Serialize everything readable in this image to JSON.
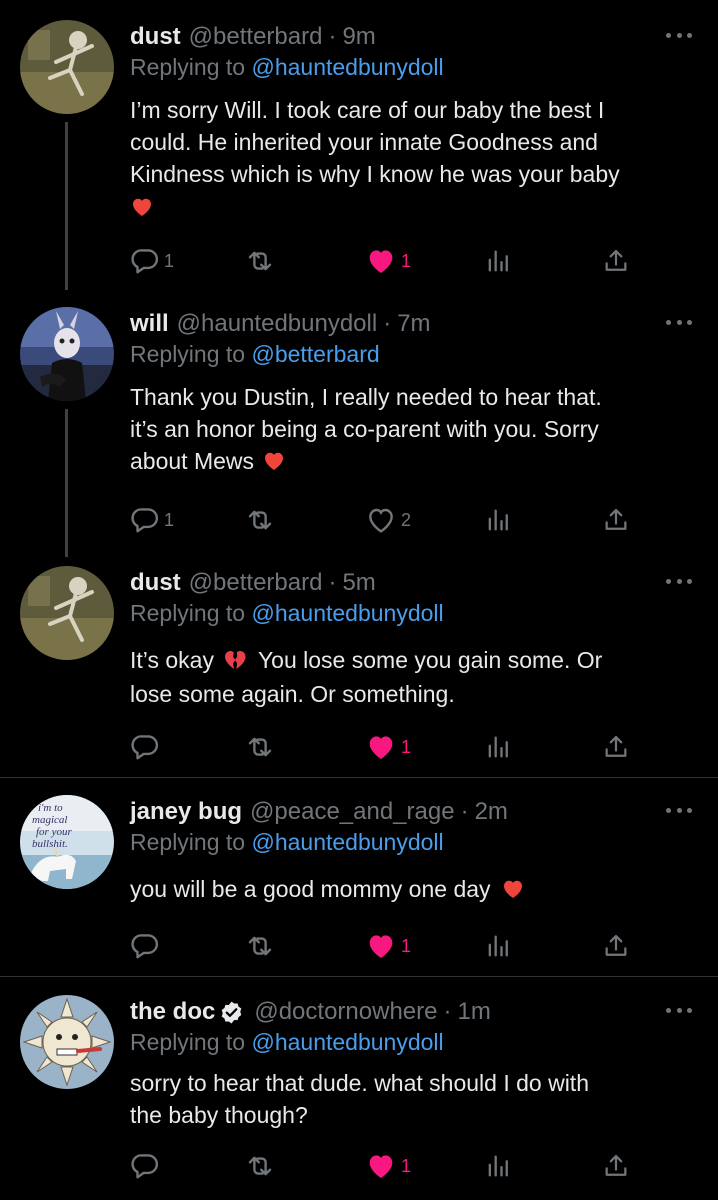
{
  "tweets": [
    {
      "name": "dust",
      "handle": "@betterbard",
      "time": "9m",
      "replying_prefix": "Replying to",
      "replying_to": "@hauntedbunydoll",
      "lines": [
        "I’m sorry Will. I took care of our baby the best I",
        "could. He inherited your innate Goodness and",
        "Kindness which is why I know he was your baby"
      ],
      "emoji": "red-heart",
      "reply_count": "1",
      "retweet_count": "",
      "like_count": "1",
      "liked": true,
      "avatar": "skeleton-dancing-avatar"
    },
    {
      "name": "will",
      "handle": "@hauntedbunydoll",
      "time": "7m",
      "replying_prefix": "Replying to",
      "replying_to": "@betterbard",
      "lines": [
        "Thank you Dustin, I really needed to hear that.",
        "it’s an honor being a co-parent with you. Sorry",
        "about Mews"
      ],
      "emoji": "red-heart",
      "reply_count": "1",
      "retweet_count": "",
      "like_count": "2",
      "liked": false,
      "avatar": "bunny-mask-avatar"
    },
    {
      "name": "dust",
      "handle": "@betterbard",
      "time": "5m",
      "replying_prefix": "Replying to",
      "replying_to": "@hauntedbunydoll",
      "line1_a": "It’s okay",
      "line1_b": "You lose some you gain some. Or",
      "line2": "lose some again. Or something.",
      "emoji": "broken-heart",
      "reply_count": "",
      "retweet_count": "",
      "like_count": "1",
      "liked": true,
      "avatar": "skeleton-dancing-avatar"
    },
    {
      "name": "janey bug",
      "handle": "@peace_and_rage",
      "time": "2m",
      "replying_prefix": "Replying to",
      "replying_to": "@hauntedbunydoll",
      "text": "you will be a good mommy one day",
      "emoji": "red-heart",
      "reply_count": "",
      "retweet_count": "",
      "like_count": "1",
      "liked": true,
      "avatar": "unicorn-meme-avatar",
      "avatar_text": [
        "i'm to",
        "magical",
        "for your",
        "bullshit."
      ]
    },
    {
      "name": "the doc",
      "handle": "@doctornowhere",
      "time": "1m",
      "verified": true,
      "replying_prefix": "Replying to",
      "replying_to": "@hauntedbunydoll",
      "lines": [
        "sorry to hear that dude. what should I do with",
        "the baby though?"
      ],
      "reply_count": "",
      "retweet_count": "",
      "like_count": "1",
      "liked": true,
      "avatar": "sun-face-avatar"
    }
  ],
  "colors": {
    "background": "#000000",
    "text": "#e7e9ea",
    "muted": "#71767b",
    "mention": "#4a9eeb",
    "like": "#f91880",
    "divider": "#2f3336"
  }
}
